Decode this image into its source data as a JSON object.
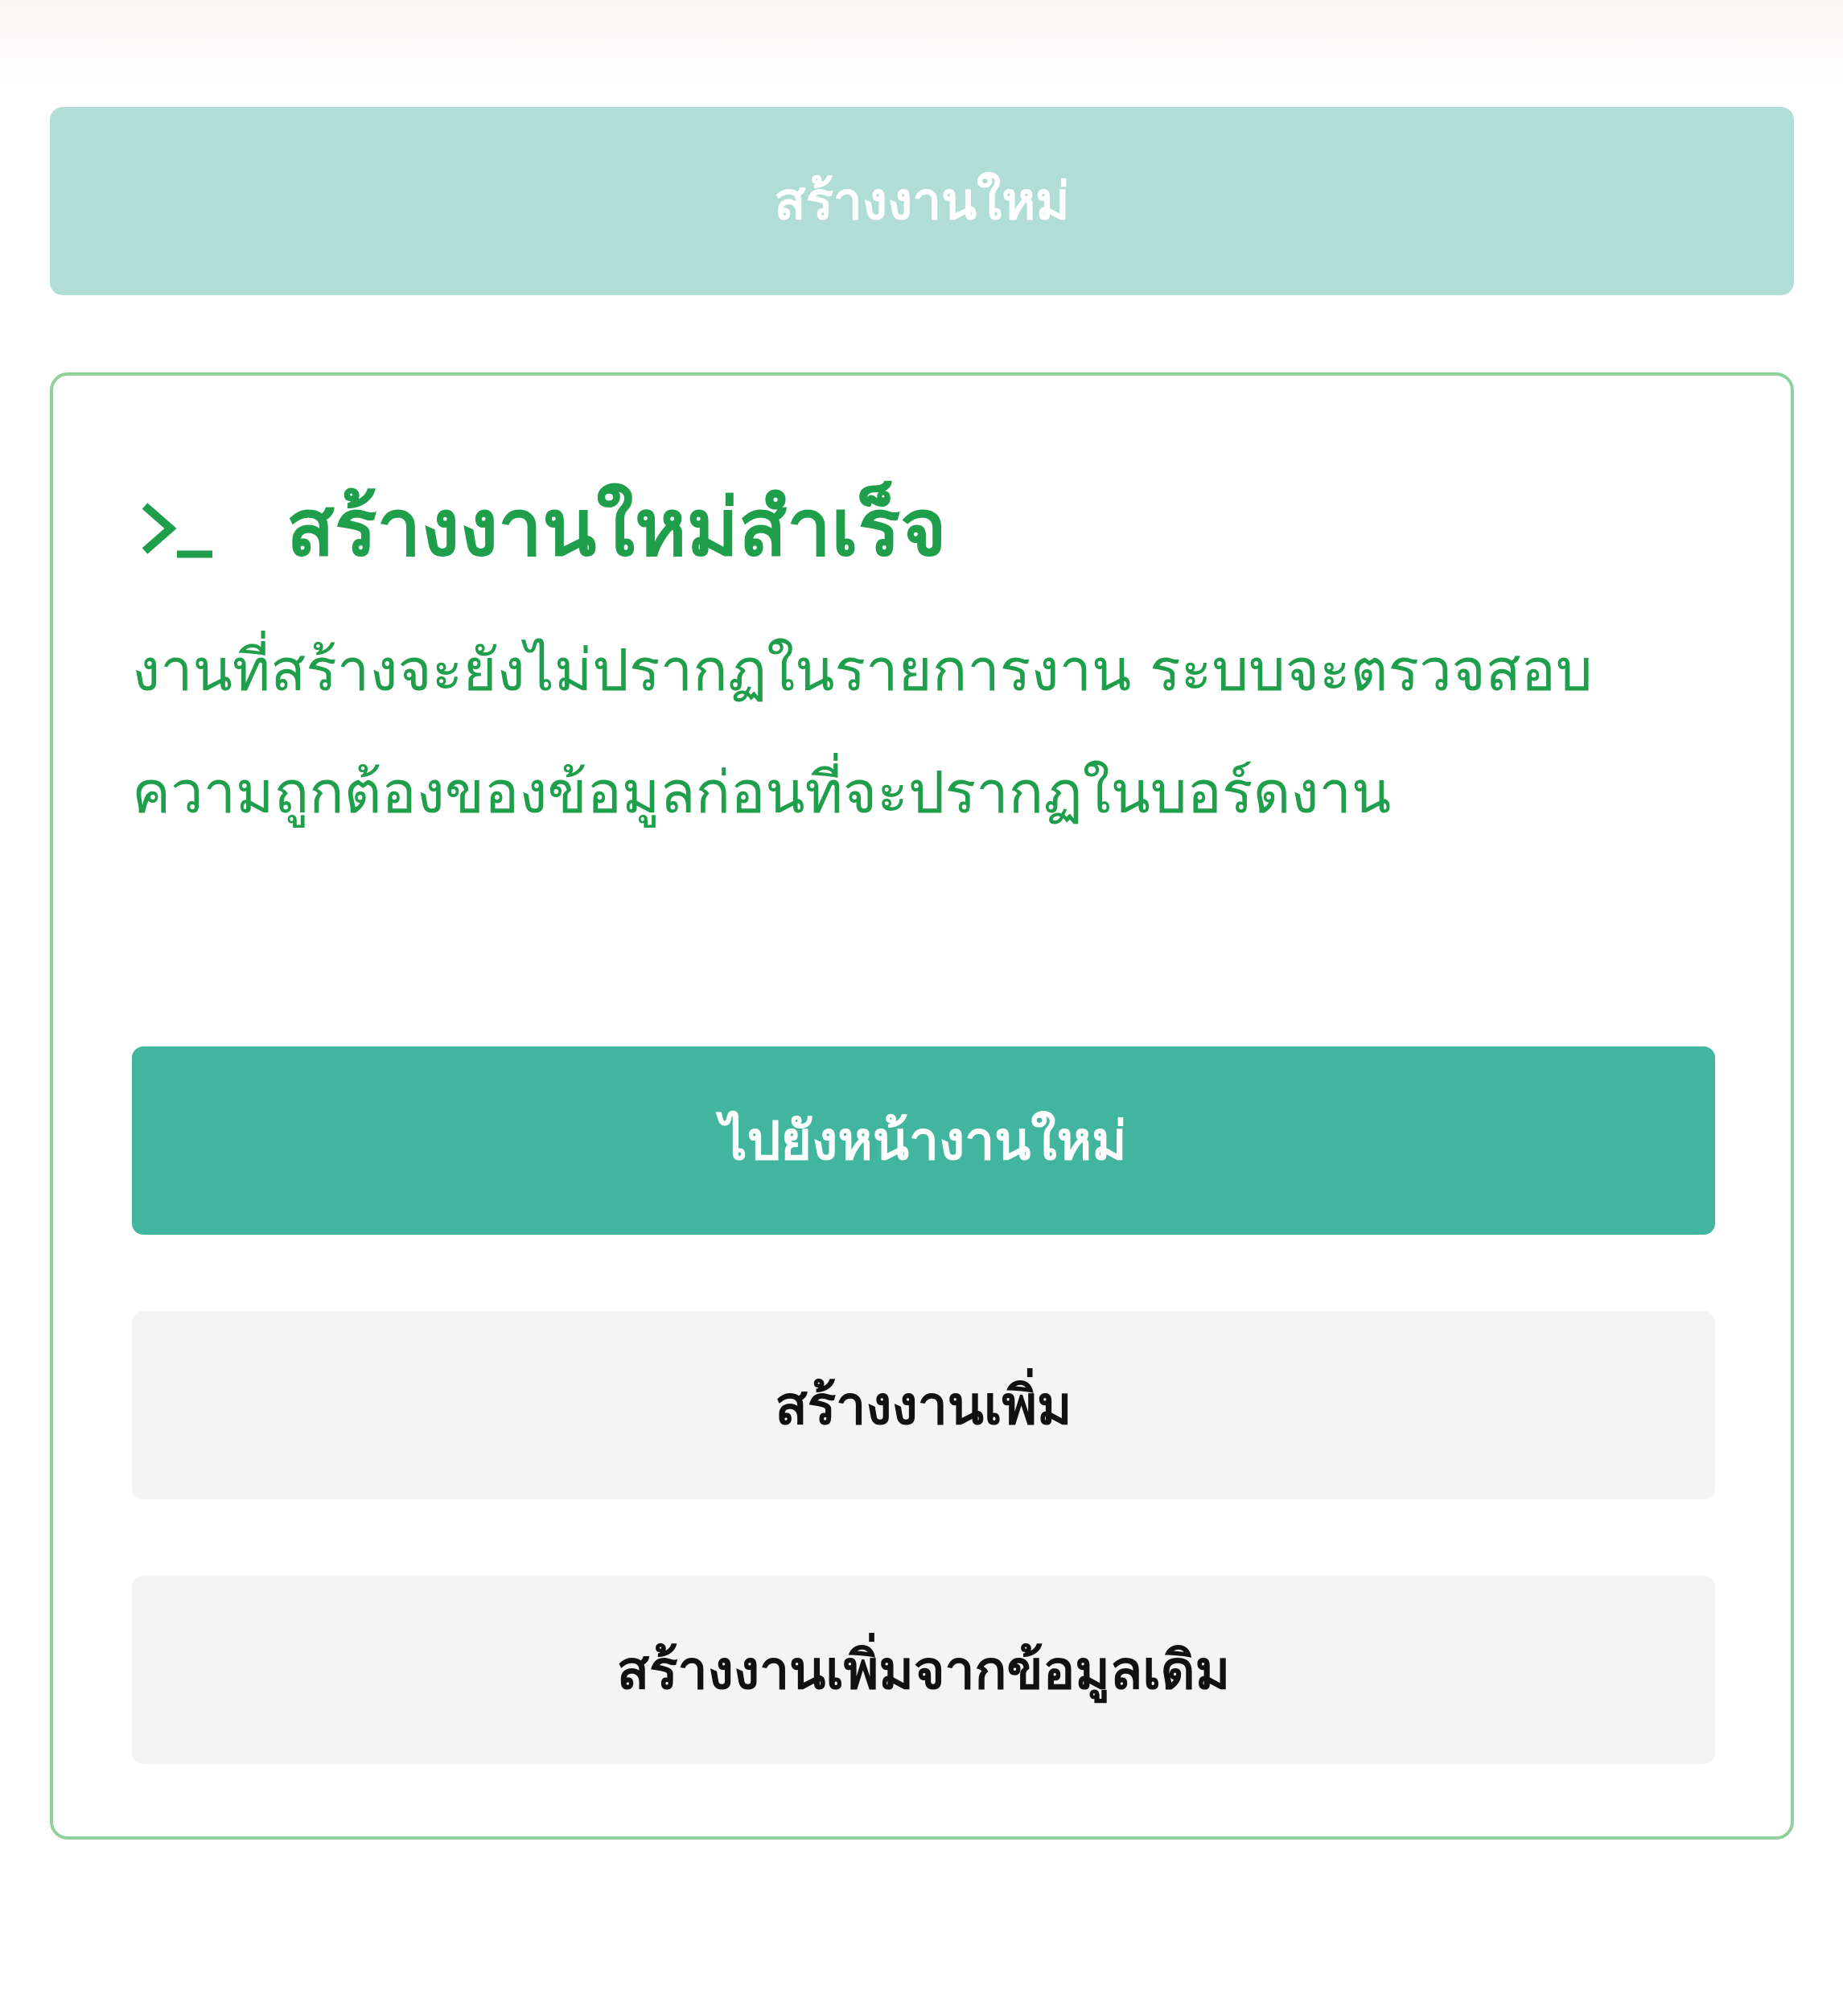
{
  "top_button": {
    "label": "สร้างงานใหม่",
    "bg_color": "#b0ded4"
  },
  "result_card": {
    "icon": "terminal-prompt-icon",
    "title": "สร้างงานใหม่สำเร็จ",
    "message": "งานที่สร้างจะยังไม่ปรากฏในรายการงาน ระบบจะตรวจสอบความถูกต้องของข้อมูลก่อนที่จะปรากฏในบอร์ดงาน",
    "accent_color": "#1f9e4b",
    "border_color": "#8fd199",
    "actions": {
      "go_to_new_job": "ไปยังหน้างานใหม่",
      "create_more": "สร้างงานเพิ่ม",
      "create_from_existing": "สร้างงานเพิ่มจากข้อมูลเดิม"
    },
    "primary_color": "#42b59f",
    "secondary_bg": "#f4f4f4"
  }
}
